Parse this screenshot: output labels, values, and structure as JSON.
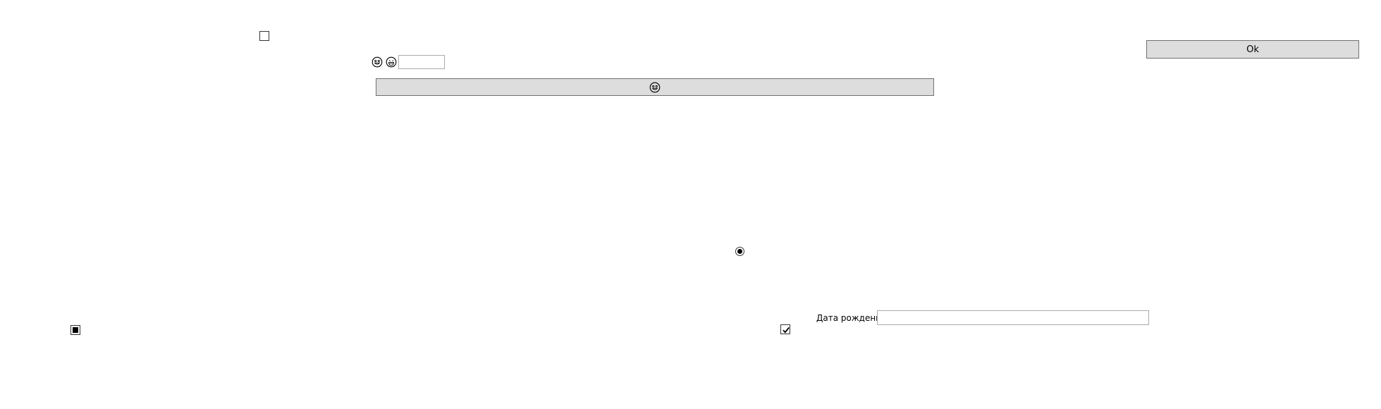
{
  "buttons": {
    "ok_label": "Ok",
    "emoji_button_icon": "smiling-face-icon"
  },
  "controls": {
    "checkbox_top": {
      "state": "unchecked"
    },
    "checkbox_bottom_left": {
      "state": "indeterminate"
    },
    "checkbox_bottom_right": {
      "state": "checked"
    },
    "radio_center": {
      "state": "selected"
    }
  },
  "emoji_row": {
    "icons": [
      "smiling-face-icon",
      "grinning-face-icon"
    ],
    "input_value": ""
  },
  "birth_date": {
    "label": "Дата рождения",
    "input_value": ""
  },
  "colors": {
    "button_bg": "#dddddd",
    "button_border": "#707070",
    "textbox_border": "#ababab"
  }
}
